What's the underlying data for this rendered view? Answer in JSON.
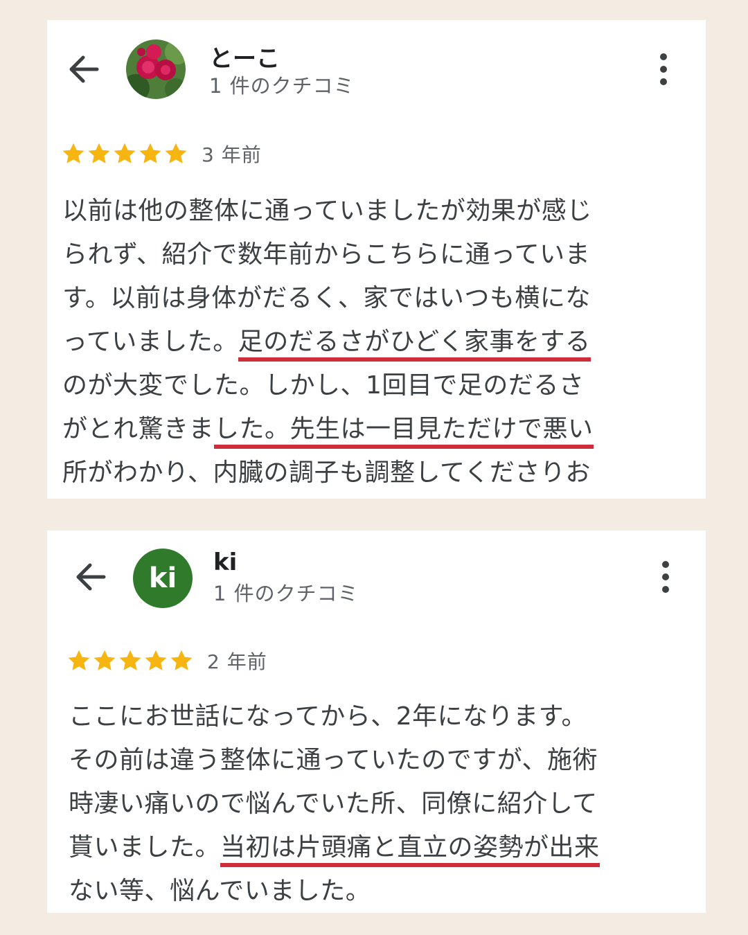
{
  "reviews": [
    {
      "avatar_icon": "flower-photo",
      "name": "とーこ",
      "review_count": "1 件のクチコミ",
      "rating": 5,
      "time": "3 年前",
      "lines": [
        {
          "text": "以前は他の整体に通っていましたが効果が感じ",
          "hl": ""
        },
        {
          "text": "られず、紹介で数年前からこちらに通っていま",
          "hl": ""
        },
        {
          "text": "す。以前は身体がだるく、家ではいつも横にな",
          "hl": ""
        },
        {
          "text": "っていました。",
          "hl": "足のだるさがひどく家事をする"
        },
        {
          "text": "のが大変でした。しかし、1回目で足のだるさ",
          "hl": ""
        },
        {
          "text": "がとれ驚きま",
          "hl": "した。先生は一目見ただけで悪い"
        },
        {
          "text": "所がわかり、内臓の調子も調整してくださりお",
          "hl": ""
        }
      ]
    },
    {
      "avatar_text": "ki",
      "avatar_color": "#2f7a2b",
      "name": "ki",
      "review_count": "1 件のクチコミ",
      "rating": 5,
      "time": "2 年前",
      "lines": [
        {
          "text": "ここにお世話になってから、2年になります。",
          "hl": ""
        },
        {
          "text": "その前は違う整体に通っていたのですが、施術",
          "hl": ""
        },
        {
          "text": "時凄い痛いので悩んでいた所、同僚に紹介して",
          "hl": ""
        },
        {
          "text": "貰いました。",
          "hl": "当初は片頭痛と直立の姿勢が出来"
        },
        {
          "text": "ない等、悩んでいました。",
          "hl": ""
        }
      ]
    }
  ],
  "colors": {
    "background": "#f4ebe3",
    "star": "#f6b511",
    "underline": "#cf2d3a"
  },
  "icons": [
    "back-arrow-icon",
    "more-vert-icon",
    "star-icon"
  ]
}
